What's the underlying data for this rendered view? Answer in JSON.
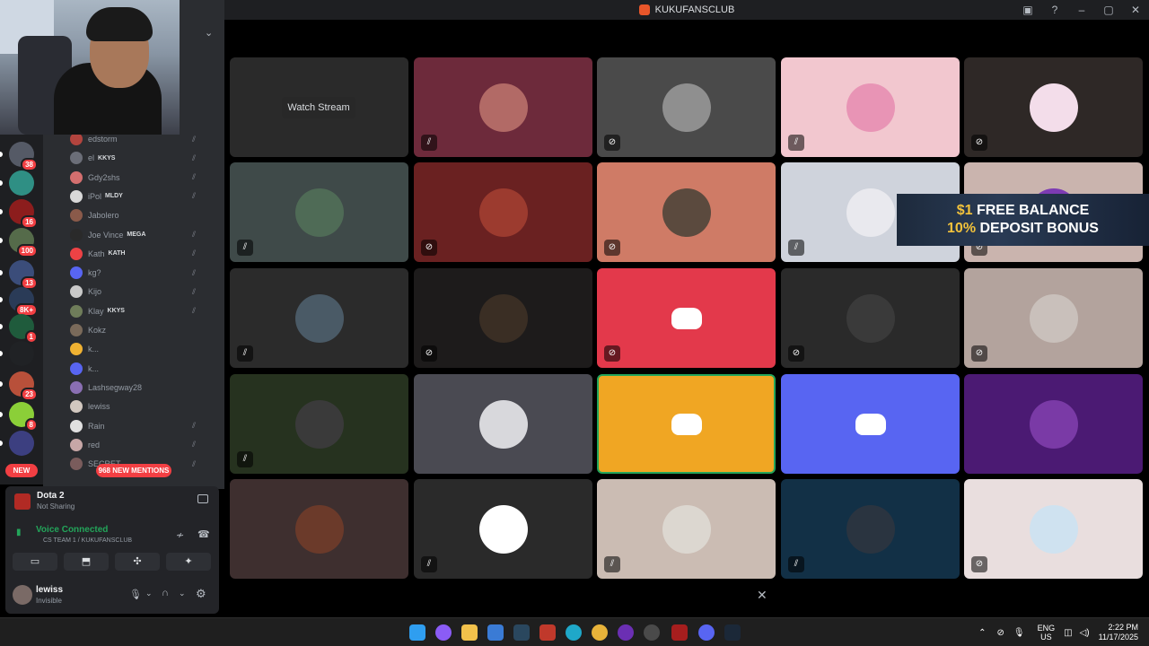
{
  "window": {
    "title": "KUKUFANSCLUB",
    "controls": [
      "minimize",
      "maximize",
      "close"
    ]
  },
  "guilds": [
    {
      "badge": "38",
      "color": "#555a66",
      "y": 0
    },
    {
      "badge": "",
      "color": "#2f8f84",
      "y": 0
    },
    {
      "badge": "16",
      "color": "#8c1d1d",
      "y": 0
    },
    {
      "badge": "100",
      "color": "#556b4a",
      "y": 0
    },
    {
      "badge": "13",
      "color": "#3b4d7a",
      "y": 0
    },
    {
      "badge": "8K+",
      "color": "#2a3b57",
      "y": 0
    },
    {
      "badge": "1",
      "color": "#1f5b3c",
      "y": 0
    },
    {
      "badge": "",
      "color": "#202225",
      "y": 0
    },
    {
      "badge": "23",
      "color": "#b8503a",
      "y": 0
    },
    {
      "badge": "8",
      "color": "#8bcf38",
      "y": 0
    },
    {
      "badge": "",
      "color": "#3c3f80",
      "y": 0
    }
  ],
  "new_badge": "NEW",
  "mentions_badge": "968 NEW MENTIONS",
  "members": [
    {
      "name": "edstorm",
      "tag": "",
      "color": "#b2443e"
    },
    {
      "name": "el",
      "tag": "KKYS",
      "color": "#6b6e78"
    },
    {
      "name": "Gdy2shs",
      "tag": "",
      "color": "#d46f6f"
    },
    {
      "name": "iPol",
      "tag": "MLDY",
      "color": "#d9d9d9"
    },
    {
      "name": "Jabolero",
      "tag": "",
      "color": "#8a5a4a"
    },
    {
      "name": "Joe Vince",
      "tag": "MEGA",
      "color": "#2a2a2a"
    },
    {
      "name": "Kath",
      "tag": "KATH",
      "color": "#ed4245"
    },
    {
      "name": "kg?",
      "tag": "",
      "color": "#5865f2"
    },
    {
      "name": "Kijo",
      "tag": "",
      "color": "#c9c9c9"
    },
    {
      "name": "Klay",
      "tag": "KKYS",
      "color": "#6f7d5a"
    },
    {
      "name": "Kokz",
      "tag": "",
      "color": "#7a6a5a"
    },
    {
      "name": "k...",
      "tag": "",
      "color": "#f0b232"
    },
    {
      "name": "k...",
      "tag": "",
      "color": "#5865f2"
    },
    {
      "name": "Lashsegway28",
      "tag": "",
      "color": "#8a6fb3"
    },
    {
      "name": "lewiss",
      "tag": "",
      "color": "#d2c8c0"
    },
    {
      "name": "Rain",
      "tag": "",
      "color": "#e0e0e0"
    },
    {
      "name": "red",
      "tag": "",
      "color": "#c7a7a7"
    },
    {
      "name": "SECRET",
      "tag": "",
      "color": "#7a5c5c"
    }
  ],
  "activity": {
    "game": "Dota 2",
    "status": "Not Sharing"
  },
  "voice": {
    "status": "Voice Connected",
    "channel": "CS TEAM 1 / KUKUFANSCLUB"
  },
  "user": {
    "name": "lewiss",
    "status": "Invisible"
  },
  "stage": {
    "watch_label": "Watch Stream",
    "tiles": [
      {
        "bg": "#2a2a2a",
        "avatar": "",
        "icon": ""
      },
      {
        "bg": "#6d2a3b",
        "avatar": "#b26a66",
        "icon": "mic-off"
      },
      {
        "bg": "#4a4a4a",
        "avatar": "#8f8f8f",
        "icon": "deafen"
      },
      {
        "bg": "#f2c7cf",
        "avatar": "#e894b5",
        "icon": "mic-off"
      },
      {
        "bg": "#2e2826",
        "avatar": "#f3ddea",
        "icon": "deafen"
      },
      {
        "bg": "#3f4a49",
        "avatar": "#4f6b56",
        "icon": "mic-off"
      },
      {
        "bg": "#6a2121",
        "avatar": "#9c3b2f",
        "icon": "deafen"
      },
      {
        "bg": "#cf7b66",
        "avatar": "#5b4a3e",
        "icon": "deafen"
      },
      {
        "bg": "#cfd3dc",
        "avatar": "#e9e9ee",
        "icon": "mic-off"
      },
      {
        "bg": "#cab4ae",
        "avatar": "#7d3bb3",
        "icon": "deafen"
      },
      {
        "bg": "#2b2b2b",
        "avatar": "#4a5a66",
        "icon": "mic-off"
      },
      {
        "bg": "#1d1b1b",
        "avatar": "#3a2e24",
        "icon": "deafen"
      },
      {
        "bg": "#e3394b",
        "avatar": "discord",
        "icon": "deafen"
      },
      {
        "bg": "#2a2a2a",
        "avatar": "#3a3a3a",
        "icon": "deafen"
      },
      {
        "bg": "#b3a39d",
        "avatar": "#c9c0bb",
        "icon": "deafen"
      },
      {
        "bg": "#26321f",
        "avatar": "#3a3a3a",
        "icon": "mic-off"
      },
      {
        "bg": "#4a4a52",
        "avatar": "#d8d8dc",
        "icon": ""
      },
      {
        "bg": "#f0a623",
        "avatar": "discord",
        "icon": ""
      },
      {
        "bg": "#5865f2",
        "avatar": "discord",
        "icon": ""
      },
      {
        "bg": "#4b1a73",
        "avatar": "#7a3aa6",
        "icon": ""
      },
      {
        "bg": "#3e2f2f",
        "avatar": "#6b3a2a",
        "icon": ""
      },
      {
        "bg": "#2a2a2a",
        "avatar": "#ffffff",
        "icon": "mic-off"
      },
      {
        "bg": "#cbbcb3",
        "avatar": "#dcd7d0",
        "icon": "mic-off"
      },
      {
        "bg": "#123046",
        "avatar": "#2a3440",
        "icon": "mic-off"
      },
      {
        "bg": "#e9dede",
        "avatar": "#cfe2f0",
        "icon": "deafen"
      }
    ]
  },
  "ad": {
    "line1_prefix": "$1",
    "line1": "FREE BALANCE",
    "line2_prefix": "10%",
    "line2": "DEPOSIT BONUS"
  },
  "taskbar": {
    "lang_top": "ENG",
    "lang_bottom": "US",
    "time": "2:22 PM",
    "date": "11/17/2025"
  }
}
